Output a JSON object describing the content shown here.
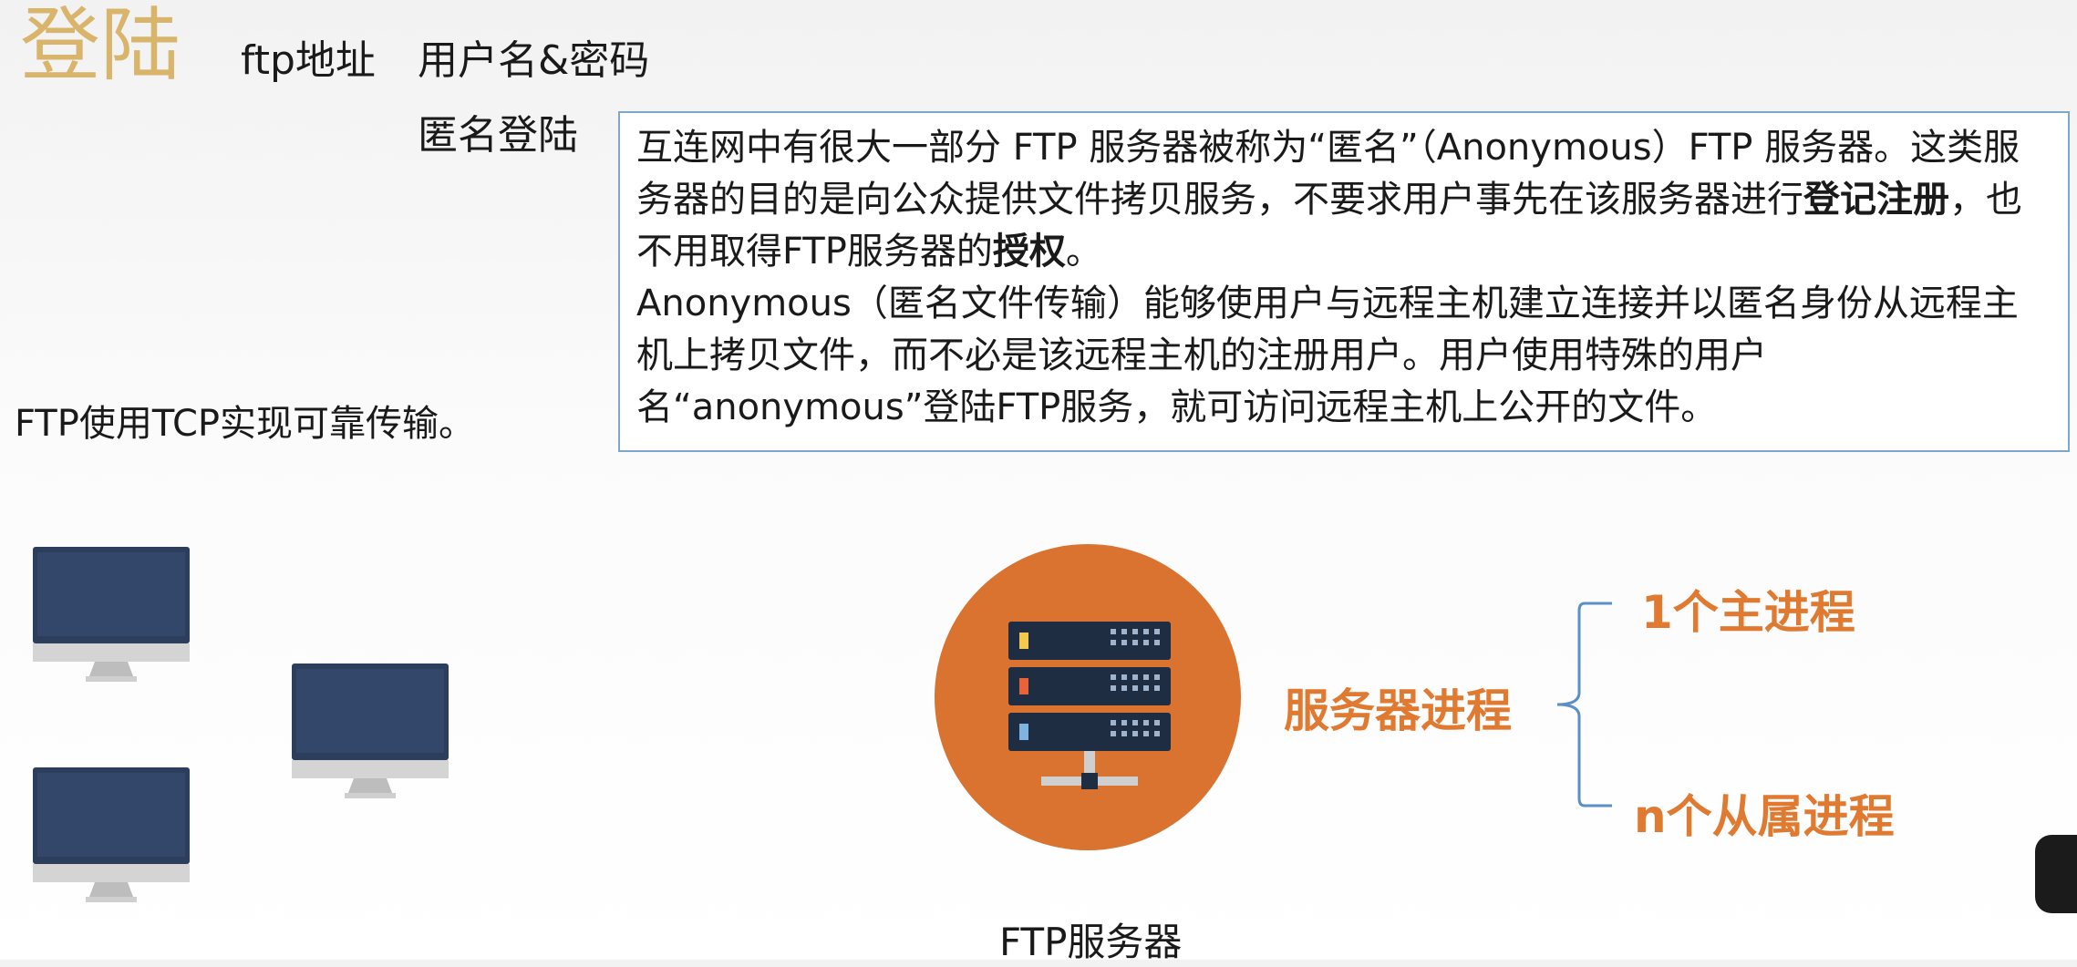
{
  "slide": {
    "title": "登陆",
    "ftp_address": "ftp地址",
    "user_password": "用户名&密码",
    "anonymous_login": "匿名登陆",
    "tcp_note": "FTP使用TCP实现可靠传输。"
  },
  "info_box": {
    "p1_part1": "互连网中有很大一部分 FTP 服务器被称为“匿名”（Anonymous）FTP 服务器。这类服务器的目的是向公众提供文件拷贝服务，不要求用户事先在该服务器进行",
    "p1_bold1": "登记注册",
    "p1_part2": "，也不用取得FTP服务器的",
    "p1_bold2": "授权",
    "p1_part3": "。",
    "p2": "Anonymous（匿名文件传输）能够使用户与远程主机建立连接并以匿名身份从远程主机上拷贝文件，而不必是该远程主机的注册用户。用户使用特殊的用户名“anonymous”登陆FTP服务，就可访问远程主机上公开的文件。"
  },
  "diagram": {
    "server_caption": "FTP服务器",
    "server_process": "服务器进程",
    "main_process": "1个主进程",
    "sub_process": "n个从属进程",
    "colors": {
      "accent_orange": "#e07a30",
      "circle_orange": "#d9732f",
      "monitor_screen": "#2c3e5c",
      "brace_blue": "#5b8fc7",
      "title_gold": "#d8b56a"
    }
  }
}
